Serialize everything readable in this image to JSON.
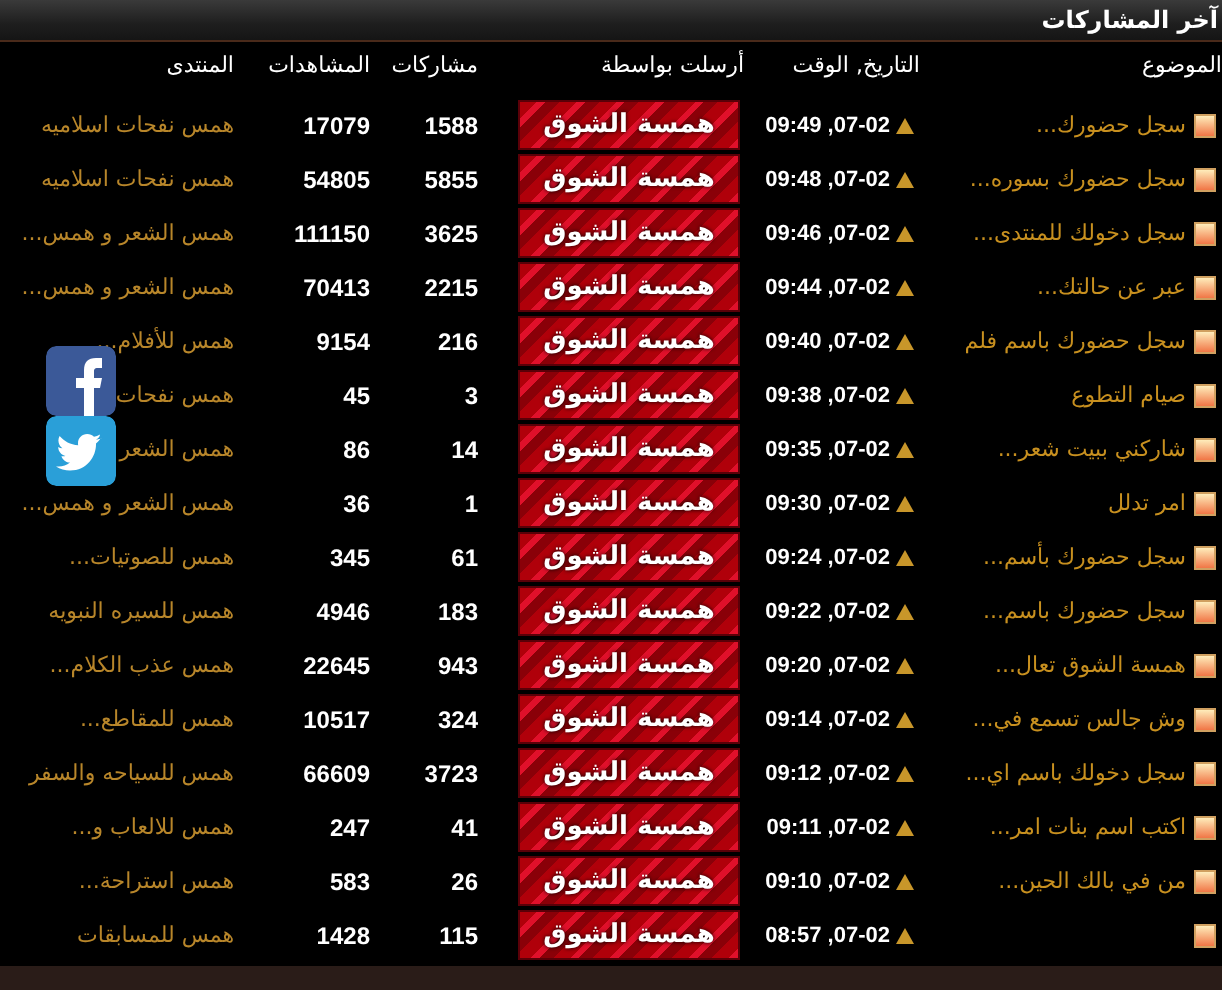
{
  "title": "آخر المشاركات",
  "columns": [
    {
      "label": "الموضوع"
    },
    {
      "label": "التاريخ, الوقت"
    },
    {
      "label": "أرسلت بواسطة"
    },
    {
      "label": "مشاركات"
    },
    {
      "label": "المشاهدات"
    },
    {
      "label": "المنتدى"
    }
  ],
  "rows": [
    {
      "topic": "سجل حضورك...",
      "date": "07-02, 09:49",
      "sender": "همسة الشوق",
      "posts": "1588",
      "views": "17079",
      "forum": "همس نفحات اسلاميه"
    },
    {
      "topic": "سجل حضورك بسوره...",
      "date": "07-02, 09:48",
      "sender": "همسة الشوق",
      "posts": "5855",
      "views": "54805",
      "forum": "همس نفحات اسلاميه"
    },
    {
      "topic": "سجل دخولك للمنتدى...",
      "date": "07-02, 09:46",
      "sender": "همسة الشوق",
      "posts": "3625",
      "views": "111150",
      "forum": "همس الشعر و همس..."
    },
    {
      "topic": "عبر عن حالتك...",
      "date": "07-02, 09:44",
      "sender": "همسة الشوق",
      "posts": "2215",
      "views": "70413",
      "forum": "همس الشعر و همس..."
    },
    {
      "topic": "سجل حضورك باسم فلم",
      "date": "07-02, 09:40",
      "sender": "همسة الشوق",
      "posts": "216",
      "views": "9154",
      "forum": "همس للأفلام..."
    },
    {
      "topic": "صيام التطوع",
      "date": "07-02, 09:38",
      "sender": "همسة الشوق",
      "posts": "3",
      "views": "45",
      "forum": "همس نفحات"
    },
    {
      "topic": "شاركني ببيت شعر...",
      "date": "07-02, 09:35",
      "sender": "همسة الشوق",
      "posts": "14",
      "views": "86",
      "forum": "همس الشعر"
    },
    {
      "topic": "امر تدلل",
      "date": "07-02, 09:30",
      "sender": "همسة الشوق",
      "posts": "1",
      "views": "36",
      "forum": "همس الشعر و همس..."
    },
    {
      "topic": "سجل حضورك بأسم...",
      "date": "07-02, 09:24",
      "sender": "همسة الشوق",
      "posts": "61",
      "views": "345",
      "forum": "همس للصوتيات..."
    },
    {
      "topic": "سجل حضورك باسم...",
      "date": "07-02, 09:22",
      "sender": "همسة الشوق",
      "posts": "183",
      "views": "4946",
      "forum": "همس للسيره النبويه"
    },
    {
      "topic": "همسة الشوق تعال...",
      "date": "07-02, 09:20",
      "sender": "همسة الشوق",
      "posts": "943",
      "views": "22645",
      "forum": "همس عذب الكلام..."
    },
    {
      "topic": "وش جالس تسمع في...",
      "date": "07-02, 09:14",
      "sender": "همسة الشوق",
      "posts": "324",
      "views": "10517",
      "forum": "همس للمقاطع..."
    },
    {
      "topic": "سجل دخولك باسم اي...",
      "date": "07-02, 09:12",
      "sender": "همسة الشوق",
      "posts": "3723",
      "views": "66609",
      "forum": "همس للسياحه والسفر"
    },
    {
      "topic": "اكتب اسم بنات امر...",
      "date": "07-02, 09:11",
      "sender": "همسة الشوق",
      "posts": "41",
      "views": "247",
      "forum": "همس للالعاب و..."
    },
    {
      "topic": "من في بالك الحين...",
      "date": "07-02, 09:10",
      "sender": "همسة الشوق",
      "posts": "26",
      "views": "583",
      "forum": "همس استراحة..."
    },
    {
      "date": "07-02, 08:57",
      "sender": "همسة الشوق",
      "posts": "115",
      "views": "1428",
      "forum": "همس للمسابقات"
    }
  ]
}
